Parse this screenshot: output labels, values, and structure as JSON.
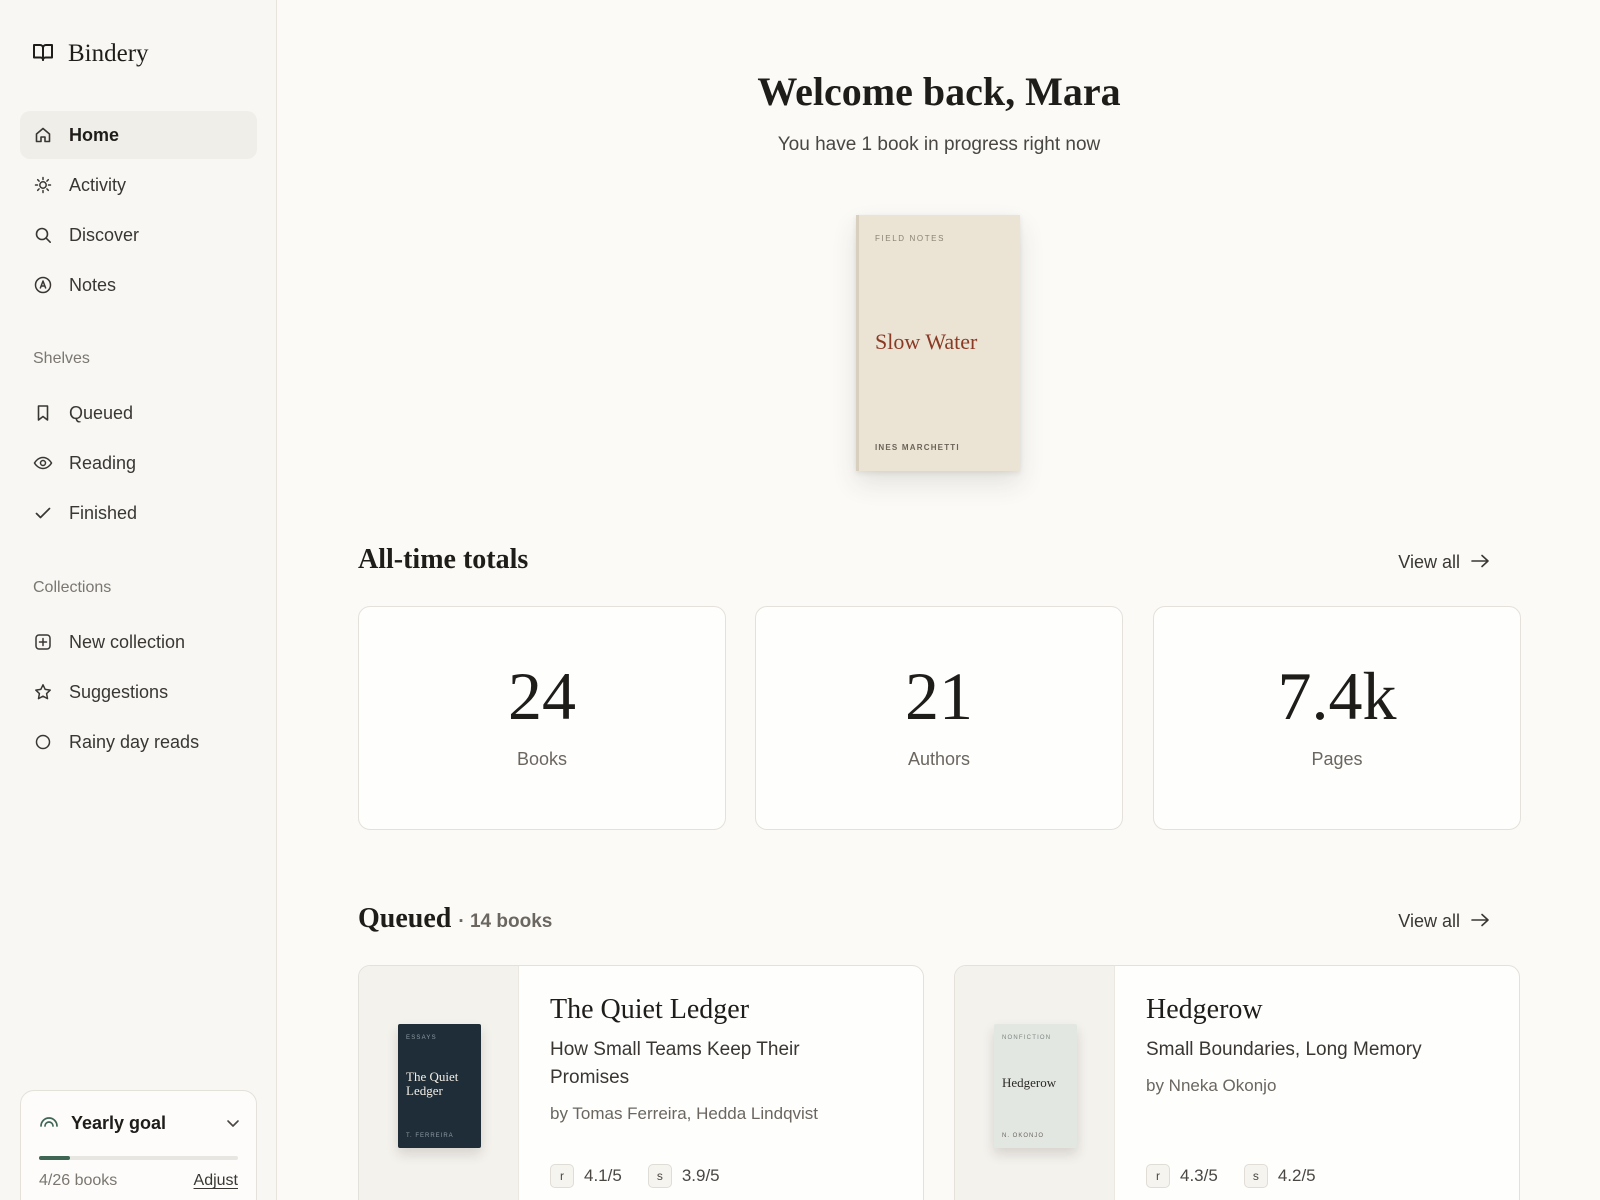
{
  "app": {
    "name": "Bindery"
  },
  "sidebar": {
    "nav": [
      {
        "label": "Home",
        "icon": "home-icon",
        "active": true
      },
      {
        "label": "Activity",
        "icon": "sun-icon"
      },
      {
        "label": "Discover",
        "icon": "search-icon"
      },
      {
        "label": "Notes",
        "icon": "at-sign-icon"
      }
    ],
    "shelves_label": "Shelves",
    "shelves": [
      {
        "label": "Queued",
        "icon": "bookmark-icon"
      },
      {
        "label": "Reading",
        "icon": "eye-icon"
      },
      {
        "label": "Finished",
        "icon": "check-icon"
      }
    ],
    "collections_label": "Collections",
    "collections": [
      {
        "label": "New collection",
        "icon": "plus-square-icon"
      },
      {
        "label": "Suggestions",
        "icon": "star-icon"
      },
      {
        "label": "Rainy day reads",
        "icon": "circle-icon"
      }
    ],
    "goal": {
      "title": "Yearly goal",
      "progress_text": "4/26 books",
      "progress_fraction": 0.154,
      "adjust_label": "Adjust"
    }
  },
  "main": {
    "welcome_title": "Welcome back, Mara",
    "welcome_subtitle": "You have 1 book in progress right now",
    "current_book": {
      "kicker": "FIELD NOTES",
      "title": "Slow Water",
      "author": "INES MARCHETTI"
    },
    "totals": {
      "title": "All-time totals",
      "view_all": "View all",
      "stats": [
        {
          "value": "24",
          "label": "Books"
        },
        {
          "value": "21",
          "label": "Authors"
        },
        {
          "value": "7.4k",
          "label": "Pages"
        }
      ]
    },
    "queued": {
      "title": "Queued",
      "count_text": "· 14 books",
      "view_all": "View all",
      "books": [
        {
          "cover_kicker": "ESSAYS",
          "cover_title": "The Quiet Ledger",
          "cover_author": "T. FERREIRA",
          "title": "The Quiet Ledger",
          "subtitle": "How Small Teams Keep Their Promises",
          "author": "by Tomas Ferreira, Hedda Lindqvist",
          "rating_r_badge": "r",
          "rating_r": "4.1/5",
          "rating_s_badge": "s",
          "rating_s": "3.9/5"
        },
        {
          "cover_kicker": "NONFICTION",
          "cover_title": "Hedgerow",
          "cover_author": "N. OKONJO",
          "title": "Hedgerow",
          "subtitle": "Small Boundaries, Long Memory",
          "author": "by Nneka Okonjo",
          "rating_r_badge": "r",
          "rating_r": "4.3/5",
          "rating_s_badge": "s",
          "rating_s": "4.2/5"
        }
      ]
    }
  },
  "colors": {
    "accent": "#3f6555",
    "background": "#fbfaf7",
    "hero_title": "#8a3a24",
    "cover_dark": "#1f2d38",
    "cover_light": "#e3e7e2"
  }
}
